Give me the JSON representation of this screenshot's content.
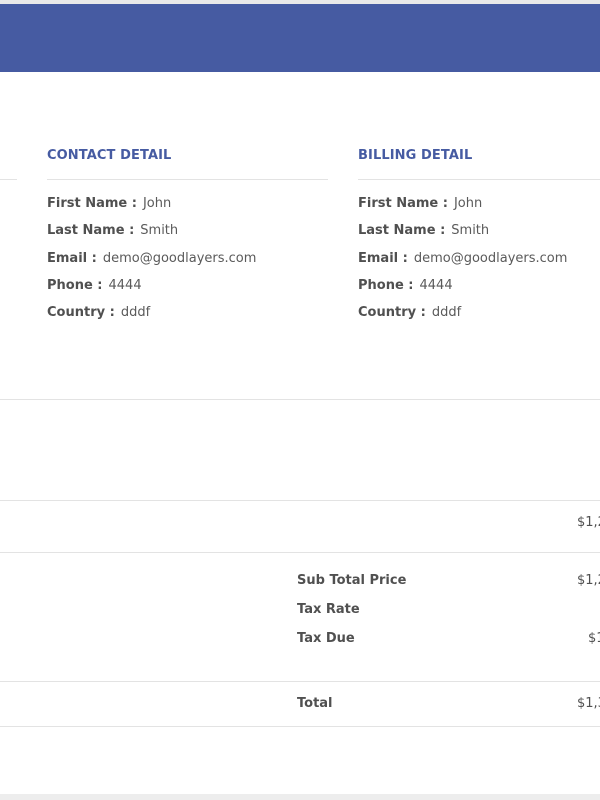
{
  "colors": {
    "header_bar": "#465ba2",
    "section_title": "#465ba2"
  },
  "contact": {
    "title": "CONTACT DETAIL",
    "fields": [
      {
        "label": "First Name :",
        "value": "John"
      },
      {
        "label": "Last Name :",
        "value": "Smith"
      },
      {
        "label": "Email :",
        "value": "demo@goodlayers.com"
      },
      {
        "label": "Phone :",
        "value": "4444"
      },
      {
        "label": "Country :",
        "value": "dddf"
      }
    ]
  },
  "billing": {
    "title": "BILLING DETAIL",
    "fields": [
      {
        "label": "First Name :",
        "value": "John"
      },
      {
        "label": "Last Name :",
        "value": "Smith"
      },
      {
        "label": "Email :",
        "value": "demo@goodlayers.com"
      },
      {
        "label": "Phone :",
        "value": "4444"
      },
      {
        "label": "Country :",
        "value": "dddf"
      }
    ]
  },
  "item_row": {
    "price": "$1,2"
  },
  "summary": {
    "sub_total_label": "Sub Total Price",
    "sub_total_value": "$1,2",
    "tax_rate_label": "Tax Rate",
    "tax_due_label": "Tax Due",
    "tax_due_value": "$1",
    "total_label": "Total",
    "total_value": "$1,3"
  }
}
